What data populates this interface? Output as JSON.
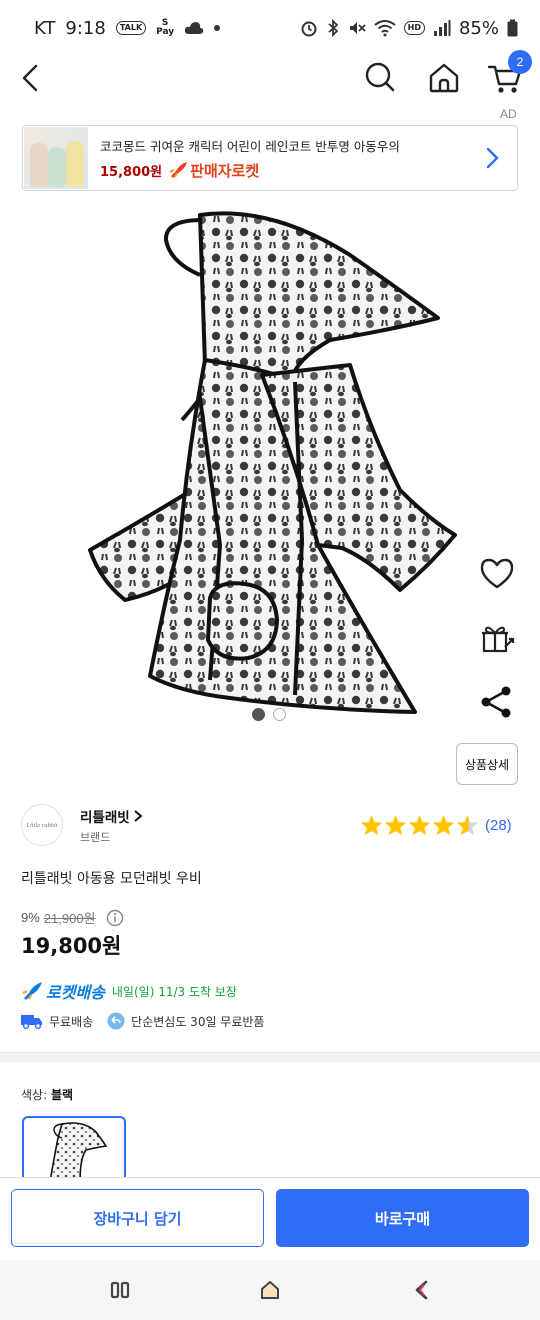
{
  "status_bar": {
    "carrier": "KT",
    "time": "9:18",
    "talk_label": "TALK",
    "pay_label": "Pay",
    "hd_label": "HD",
    "battery": "85%",
    "icons": [
      "kakaotalk-icon",
      "samsung-pay-icon",
      "cloud-icon",
      "alarm-icon",
      "bluetooth-icon",
      "mute-icon",
      "wifi-icon",
      "signal-icon",
      "battery-icon"
    ]
  },
  "nav": {
    "icons": [
      "back-arrow-icon",
      "search-icon",
      "home-icon",
      "cart-icon"
    ],
    "cart_count": "2"
  },
  "ad": {
    "label": "AD",
    "title": "코코몽드 귀여운 캐릭터 어린이 레인코트 반투명 아동우의",
    "price": "15,800원",
    "seller_badge": "판매자로켓"
  },
  "gallery": {
    "total_images": 2,
    "current_index": 1,
    "side_icons": [
      "heart-icon",
      "gift-icon",
      "share-icon"
    ]
  },
  "detail_button": "상품상세",
  "brand": {
    "logo_text": "Little rabbit",
    "name": "리틀래빗",
    "sub": "브랜드"
  },
  "rating": {
    "stars": 4.5,
    "count": "(28)"
  },
  "product": {
    "name": "리틀래빗 아동용 모던래빗 우비",
    "discount": "9%",
    "original_price": "21,900원",
    "sale_price": "19,800원"
  },
  "delivery": {
    "rocket_label": "로켓배송",
    "eta": "내일(일) 11/3 도착 보장",
    "free_shipping": "무료배송",
    "free_return": "단순변심도 30일 무료반품"
  },
  "option": {
    "label": "색상:",
    "value": "블랙"
  },
  "bottom": {
    "cart_button": "장바구니 담기",
    "buy_button": "바로구매"
  },
  "colors": {
    "accent_blue": "#2f6df6",
    "price_red": "#ae0000",
    "rocket_blue": "#0a7ce0",
    "eta_green": "#14a23d",
    "star": "#ffc400"
  }
}
